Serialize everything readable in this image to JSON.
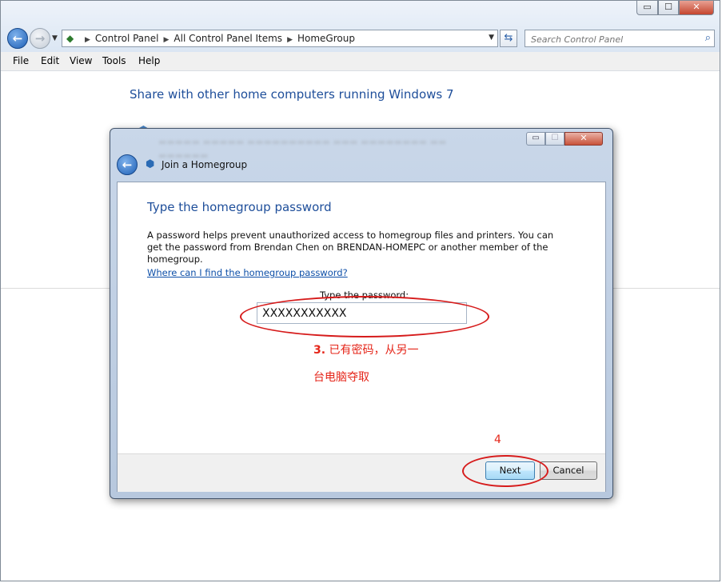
{
  "window": {
    "caption_buttons": {
      "minimize": "▭",
      "maximize": "☐",
      "close": "✕"
    }
  },
  "nav": {
    "back_glyph": "←",
    "forward_glyph": "→",
    "breadcrumbs": [
      "Control Panel",
      "All Control Panel Items",
      "HomeGroup"
    ],
    "search_placeholder": "Search Control Panel"
  },
  "menubar": {
    "items": [
      "File",
      "Edit",
      "View",
      "Tools",
      "Help"
    ]
  },
  "background": {
    "heading": "Share with other home computers running Windows 7"
  },
  "dialog": {
    "title": "Join a Homegroup",
    "heading": "Type the homegroup password",
    "description": "A password helps prevent unauthorized access to homegroup files and printers. You can get the password from Brendan Chen on BRENDAN-HOMEPC or another member of the homegroup.",
    "help_link": "Where can I find the homegroup password?",
    "password_label": "Type the password:",
    "password_value": "XXXXXXXXXXX",
    "next_label": "Next",
    "cancel_label": "Cancel"
  },
  "annotations": {
    "step3_number": "3.",
    "step3_text_line1": "已有密码，从另一",
    "step3_text_line2": "台电脑夺取",
    "step4": "4",
    "highlight_color": "#d61b1b"
  },
  "icons": {
    "control_panel": "control-panel-icon",
    "search": "search-icon",
    "refresh": "refresh-icon",
    "homegroup": "homegroup-icon"
  }
}
